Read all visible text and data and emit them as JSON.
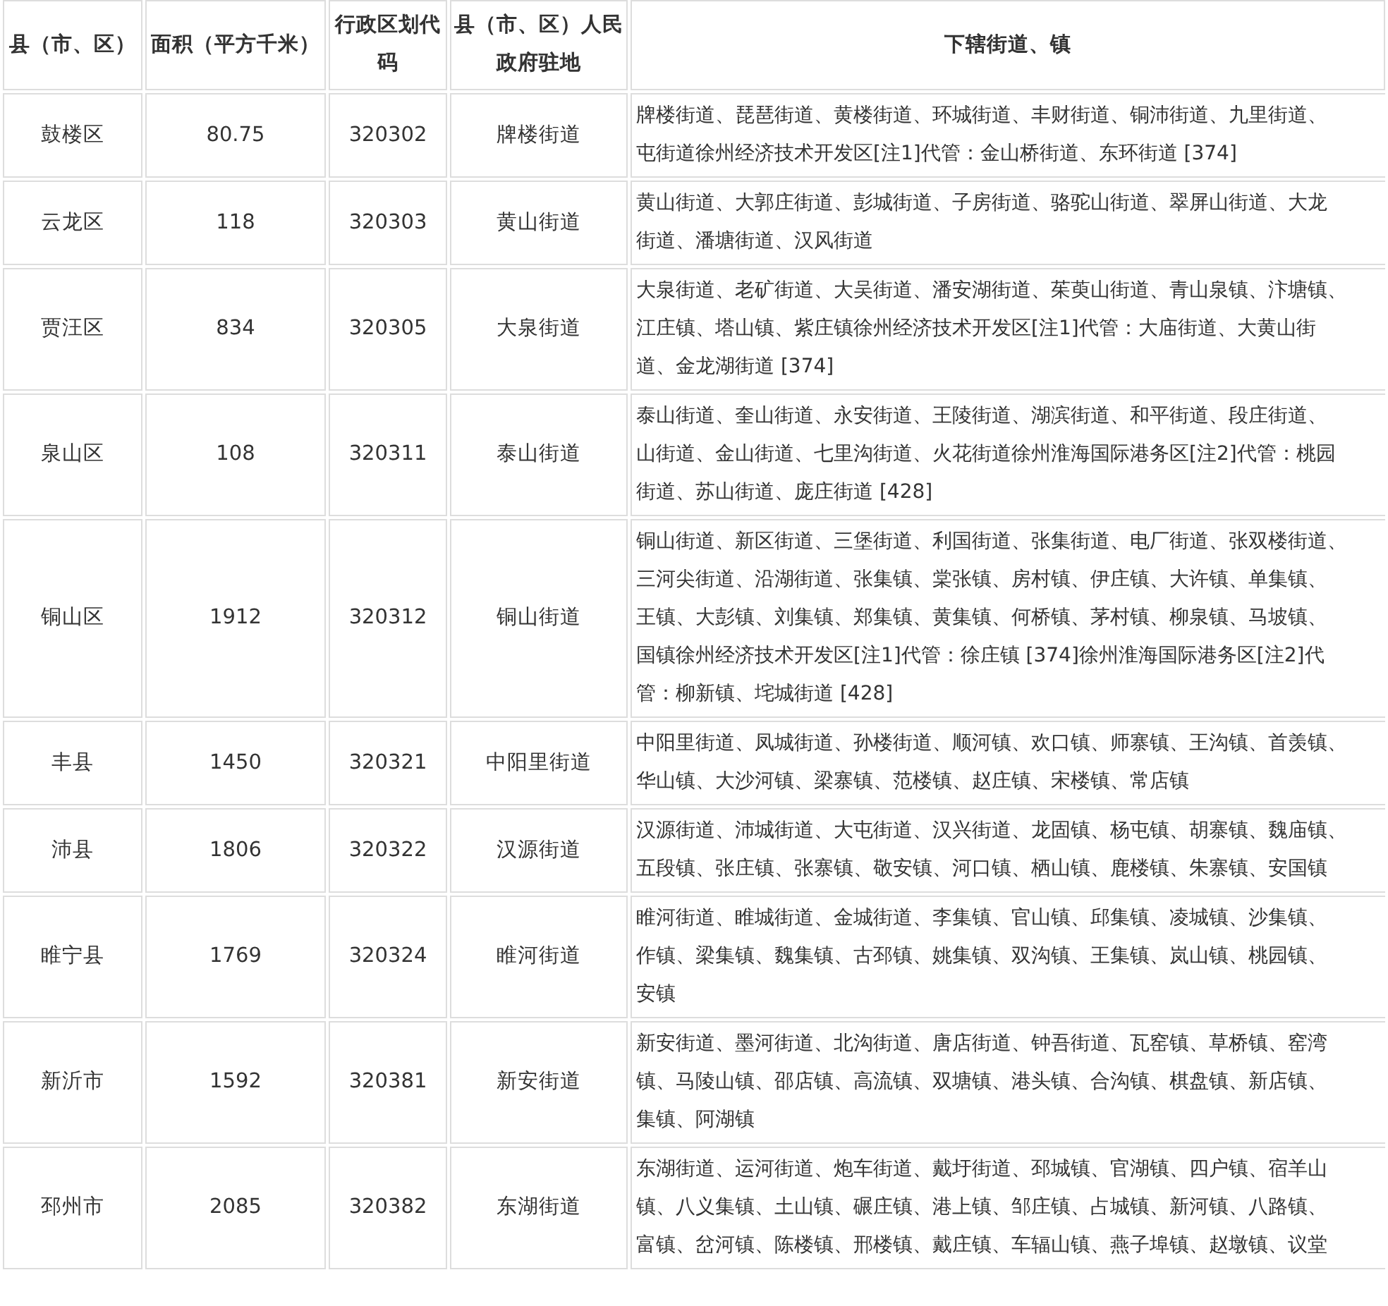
{
  "table": {
    "columns": [
      "县（市、区）",
      "面积（平方千米）",
      "行政区划代码",
      "县（市、区）人民政府驻地",
      "下辖街道、镇"
    ],
    "rows": [
      {
        "county": "鼓楼区",
        "area": "80.75",
        "code": "320302",
        "seat": "牌楼街道",
        "subdivision_lines": [
          "牌楼街道、琵琶街道、黄楼街道、环城街道、丰财街道、铜沛街道、九里街道、",
          "屯街道徐州经济技术开发区[注1]代管：金山桥街道、东环街道 [374]"
        ]
      },
      {
        "county": "云龙区",
        "area": "118",
        "code": "320303",
        "seat": "黄山街道",
        "subdivision_lines": [
          "黄山街道、大郭庄街道、彭城街道、子房街道、骆驼山街道、翠屏山街道、大龙",
          "街道、潘塘街道、汉风街道"
        ]
      },
      {
        "county": "贾汪区",
        "area": "834",
        "code": "320305",
        "seat": "大泉街道",
        "subdivision_lines": [
          "大泉街道、老矿街道、大吴街道、潘安湖街道、茱萸山街道、青山泉镇、汴塘镇、",
          "江庄镇、塔山镇、紫庄镇徐州经济技术开发区[注1]代管：大庙街道、大黄山街",
          "道、金龙湖街道 [374]"
        ]
      },
      {
        "county": "泉山区",
        "area": "108",
        "code": "320311",
        "seat": "泰山街道",
        "subdivision_lines": [
          "泰山街道、奎山街道、永安街道、王陵街道、湖滨街道、和平街道、段庄街道、",
          "山街道、金山街道、七里沟街道、火花街道徐州淮海国际港务区[注2]代管：桃园",
          "街道、苏山街道、庞庄街道 [428]"
        ]
      },
      {
        "county": "铜山区",
        "area": "1912",
        "code": "320312",
        "seat": "铜山街道",
        "subdivision_lines": [
          "铜山街道、新区街道、三堡街道、利国街道、张集街道、电厂街道、张双楼街道、",
          "三河尖街道、沿湖街道、张集镇、棠张镇、房村镇、伊庄镇、大许镇、单集镇、",
          "王镇、大彭镇、刘集镇、郑集镇、黄集镇、何桥镇、茅村镇、柳泉镇、马坡镇、",
          "国镇徐州经济技术开发区[注1]代管：徐庄镇 [374]徐州淮海国际港务区[注2]代",
          "管：柳新镇、垞城街道 [428]"
        ]
      },
      {
        "county": "丰县",
        "area": "1450",
        "code": "320321",
        "seat": "中阳里街道",
        "subdivision_lines": [
          "中阳里街道、凤城街道、孙楼街道、顺河镇、欢口镇、师寨镇、王沟镇、首羡镇、",
          "华山镇、大沙河镇、梁寨镇、范楼镇、赵庄镇、宋楼镇、常店镇"
        ]
      },
      {
        "county": "沛县",
        "area": "1806",
        "code": "320322",
        "seat": "汉源街道",
        "subdivision_lines": [
          "汉源街道、沛城街道、大屯街道、汉兴街道、龙固镇、杨屯镇、胡寨镇、魏庙镇、",
          "五段镇、张庄镇、张寨镇、敬安镇、河口镇、栖山镇、鹿楼镇、朱寨镇、安国镇"
        ]
      },
      {
        "county": "睢宁县",
        "area": "1769",
        "code": "320324",
        "seat": "睢河街道",
        "subdivision_lines": [
          "睢河街道、睢城街道、金城街道、李集镇、官山镇、邱集镇、凌城镇、沙集镇、",
          "作镇、梁集镇、魏集镇、古邳镇、姚集镇、双沟镇、王集镇、岚山镇、桃园镇、",
          "安镇"
        ]
      },
      {
        "county": "新沂市",
        "area": "1592",
        "code": "320381",
        "seat": "新安街道",
        "subdivision_lines": [
          "新安街道、墨河街道、北沟街道、唐店街道、钟吾街道、瓦窑镇、草桥镇、窑湾",
          "镇、马陵山镇、邵店镇、高流镇、双塘镇、港头镇、合沟镇、棋盘镇、新店镇、",
          "集镇、阿湖镇"
        ]
      },
      {
        "county": "邳州市",
        "area": "2085",
        "code": "320382",
        "seat": "东湖街道",
        "subdivision_lines": [
          "东湖街道、运河街道、炮车街道、戴圩街道、邳城镇、官湖镇、四户镇、宿羊山",
          "镇、八义集镇、土山镇、碾庄镇、港上镇、邹庄镇、占城镇、新河镇、八路镇、",
          "富镇、岔河镇、陈楼镇、邢楼镇、戴庄镇、车辐山镇、燕子埠镇、赵墩镇、议堂"
        ]
      }
    ]
  }
}
